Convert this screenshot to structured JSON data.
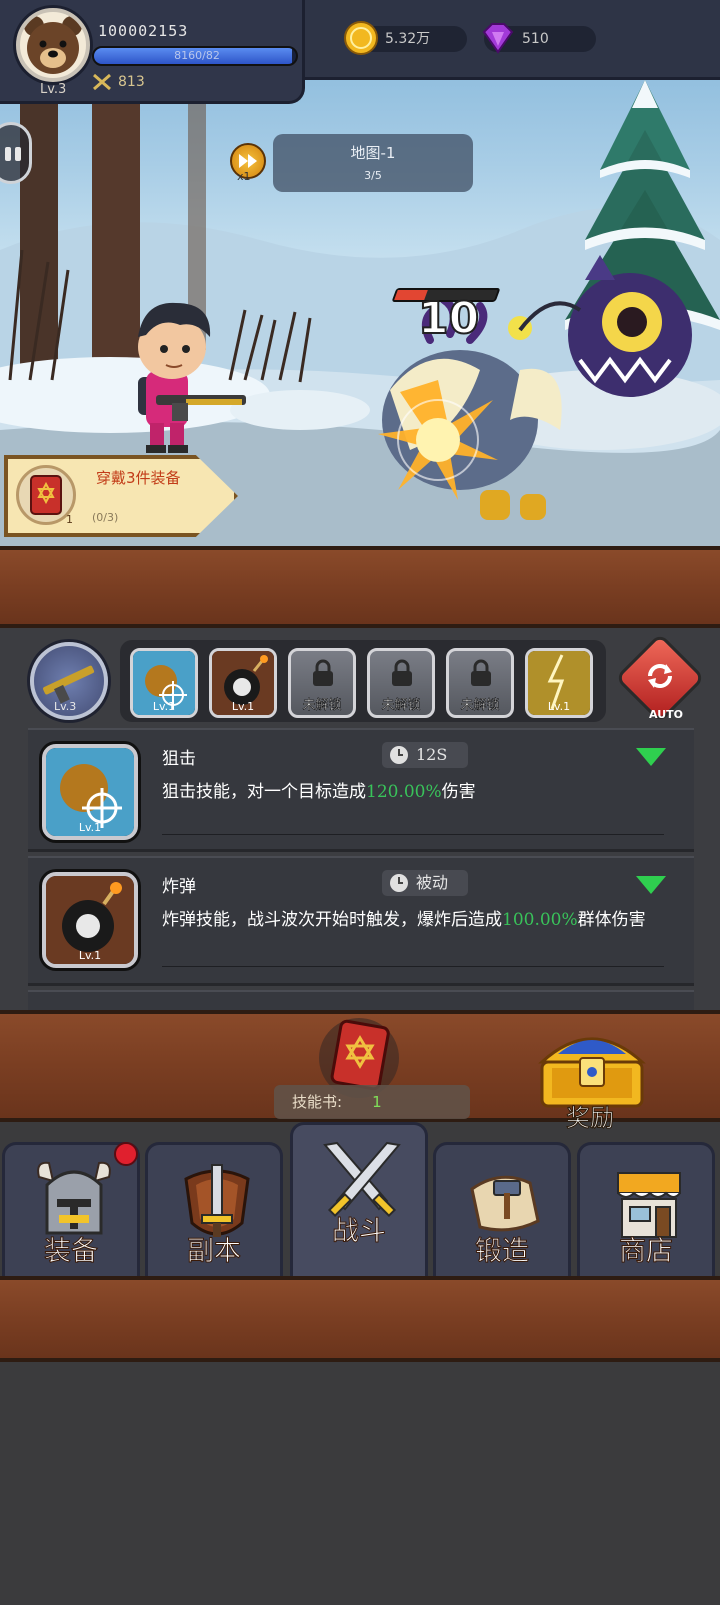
{
  "player": {
    "id": "100002153",
    "level": "Lv.3",
    "exp_text": "8160/82",
    "exp_fill": 0.98,
    "power": "813"
  },
  "resources": {
    "gold": "5.32万",
    "gems": "510"
  },
  "battle": {
    "speed": "x1",
    "map_name": "地图-1",
    "map_progress": "3/5",
    "damage": "10",
    "enemy_hp_fraction": 0.3
  },
  "quest": {
    "title": "穿戴3件装备",
    "progress": "(0/3)",
    "count": "1"
  },
  "skills_bar": {
    "weapon_level": "Lv.3",
    "slots": [
      {
        "type": "sniper",
        "label": "Lv.1"
      },
      {
        "type": "bomb",
        "label": "Lv.1"
      },
      {
        "type": "locked",
        "label": "未解锁"
      },
      {
        "type": "locked",
        "label": "未解锁"
      },
      {
        "type": "locked",
        "label": "未解锁"
      },
      {
        "type": "lightning",
        "label": "Lv.1"
      }
    ],
    "auto_label": "AUTO"
  },
  "skill_list": [
    {
      "name": "狙击",
      "cooldown": "12S",
      "level": "Lv.1",
      "desc_before": "狙击技能，对一个目标造成",
      "desc_highlight": "120.00%",
      "desc_after": "伤害"
    },
    {
      "name": "炸弹",
      "cooldown": "被动",
      "level": "Lv.1",
      "desc_before": "炸弹技能，战斗波次开始时触发，爆炸后造成",
      "desc_highlight": "100.00%",
      "desc_after": "群体伤害"
    }
  ],
  "skillbook": {
    "label": "技能书:",
    "count": "1"
  },
  "reward": {
    "label": "奖励"
  },
  "tabs": [
    {
      "id": "equipment",
      "label": "装备",
      "icon": "helmet-icon"
    },
    {
      "id": "dungeon",
      "label": "副本",
      "icon": "sword-shield-icon"
    },
    {
      "id": "battle",
      "label": "战斗",
      "icon": "crossed-swords-icon"
    },
    {
      "id": "forge",
      "label": "锻造",
      "icon": "scroll-hammer-icon"
    },
    {
      "id": "shop",
      "label": "商店",
      "icon": "shop-icon"
    }
  ],
  "colors": {
    "exp_bar": "#3a64d8",
    "highlight_green": "#39c25a",
    "hp_red": "#e24632",
    "wood": "#7a3e22"
  }
}
